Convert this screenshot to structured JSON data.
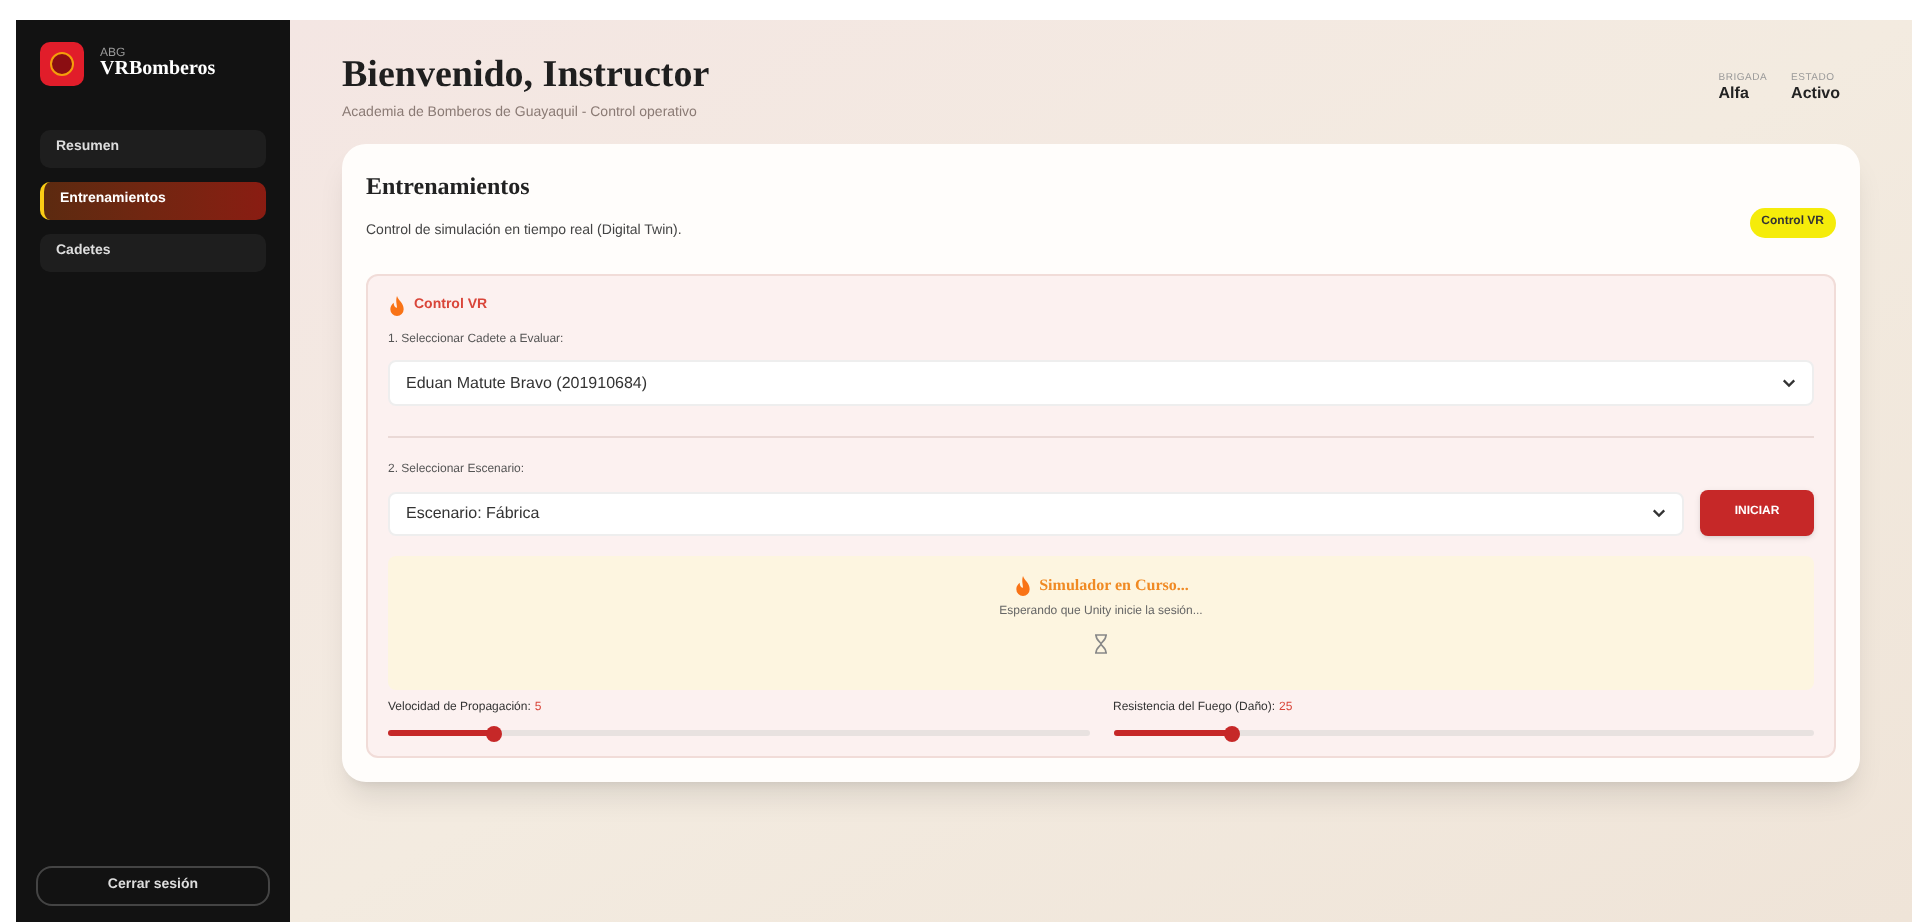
{
  "sidebar": {
    "brand_small": "ABG",
    "brand": "VRBomberos",
    "items": [
      {
        "label": "Resumen",
        "selected": false
      },
      {
        "label": "Entrenamientos",
        "selected": true
      },
      {
        "label": "Cadetes",
        "selected": false
      }
    ],
    "logout": "Cerrar sesión"
  },
  "header": {
    "title": "Bienvenido, Instructor",
    "subtitle": "Academia de Bomberos de Guayaquil - Control operativo",
    "stats": [
      {
        "label": "BRIGADA",
        "value": "Alfa"
      },
      {
        "label": "ESTADO",
        "value": "Activo"
      }
    ]
  },
  "card": {
    "title": "Entrenamientos",
    "subtitle": "Control de simulación en tiempo real (Digital Twin).",
    "badge": "Control VR",
    "panel": {
      "title": "Control VR",
      "cadet_label": "1. Seleccionar Cadete a Evaluar:",
      "cadet_value": "Eduan Matute Bravo (201910684)",
      "scenario_label": "2. Seleccionar Escenario:",
      "scenario_value": "Escenario: Fábrica",
      "start_button": "INICIAR",
      "status": {
        "title": "Simulador en Curso...",
        "message": "Esperando que Unity inicie la sesión..."
      },
      "sliders": [
        {
          "label": "Velocidad de Propagación:",
          "reading": "5",
          "level": 0.15
        },
        {
          "label": "Resistencia del Fuego (Daño):",
          "reading": "25",
          "level": 0.17
        }
      ]
    }
  }
}
